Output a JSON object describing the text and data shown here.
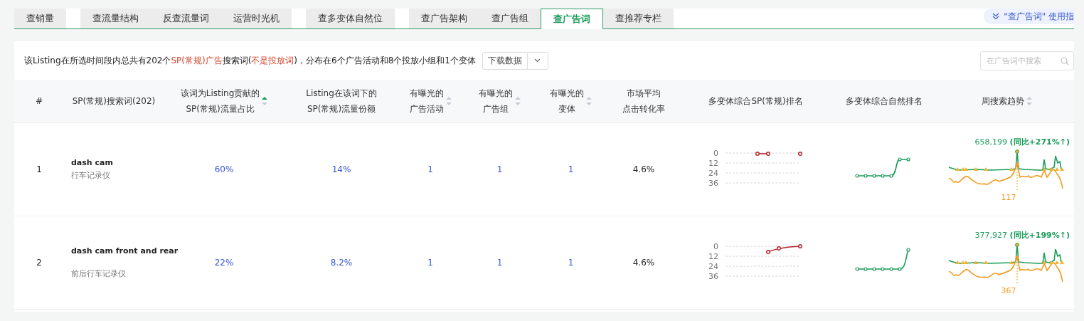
{
  "tab_groups": [
    [
      {
        "label": "查销量",
        "selected": false
      }
    ],
    [
      {
        "label": "查流量结构",
        "selected": false
      },
      {
        "label": "反查流量词",
        "selected": false
      },
      {
        "label": "运营时光机",
        "selected": false
      }
    ],
    [
      {
        "label": "查多变体自然位",
        "selected": false
      }
    ],
    [
      {
        "label": "查广告架构",
        "selected": false
      },
      {
        "label": "查广告组",
        "selected": false
      },
      {
        "label": "查广告词",
        "selected": true
      },
      {
        "label": "查推荐专栏",
        "selected": false
      }
    ]
  ],
  "guide_link": "\"查广告词\" 使用指",
  "summary": [
    {
      "text": "该Listing在所选时间段内总共有202个",
      "highlight": false
    },
    {
      "text": "SP(常规)广告",
      "highlight": true
    },
    {
      "text": "搜索词(",
      "highlight": false
    },
    {
      "text": "不是投放词",
      "highlight": true
    },
    {
      "text": ")，分布在6个广告活动和8个投放小组和1个变体",
      "highlight": false
    }
  ],
  "download_button": "下载数据",
  "search": {
    "placeholder": "在广告词中搜索"
  },
  "columns": [
    {
      "lines": [
        "#"
      ],
      "sortable": false
    },
    {
      "lines": [
        "SP(常规)搜索词(202)"
      ],
      "sortable": false
    },
    {
      "lines": [
        "该词为Listing贡献的",
        "SP(常规)流量占比"
      ],
      "sortable": true,
      "sorted_asc": true
    },
    {
      "lines": [
        "Listing在该词下的",
        "SP(常规)流量份额"
      ],
      "sortable": false
    },
    {
      "lines": [
        "有曝光的",
        "广告活动"
      ],
      "sortable": true,
      "sorted_asc": false
    },
    {
      "lines": [
        "有曝光的",
        "广告组"
      ],
      "sortable": true,
      "sorted_asc": false
    },
    {
      "lines": [
        "有曝光的",
        "变体"
      ],
      "sortable": true,
      "sorted_asc": false
    },
    {
      "lines": [
        "市场平均",
        "点击转化率"
      ],
      "sortable": false
    },
    {
      "lines": [
        "多变体综合SP(常规)排名"
      ],
      "sortable": false
    },
    {
      "lines": [
        "多变体综合自然排名"
      ],
      "sortable": false
    },
    {
      "lines": [
        "周搜索趋势"
      ],
      "sortable": true,
      "sorted_asc": false
    }
  ],
  "rows": [
    {
      "index": "1",
      "term": "dash cam",
      "translation": "行车记录仪",
      "traffic_ratio": "60%",
      "traffic_share": "14%",
      "campaigns": "1",
      "ad_groups": "1",
      "variants": "1",
      "cvr": "4.6%",
      "sp_rank_ticks": [
        "0",
        "12",
        "24",
        "36"
      ],
      "trend": {
        "total": "658,199",
        "yoy": "(同比+271%↑)",
        "marker": "117"
      }
    },
    {
      "index": "2",
      "term": "dash cam front and rear",
      "translation": "前后行车记录仪",
      "traffic_ratio": "22%",
      "traffic_share": "8.2%",
      "campaigns": "1",
      "ad_groups": "1",
      "variants": "1",
      "cvr": "4.6%",
      "sp_rank_ticks": [
        "0",
        "12",
        "24",
        "36"
      ],
      "trend": {
        "total": "377,927",
        "yoy": "(同比+199%↑)",
        "marker": "367"
      }
    }
  ]
}
